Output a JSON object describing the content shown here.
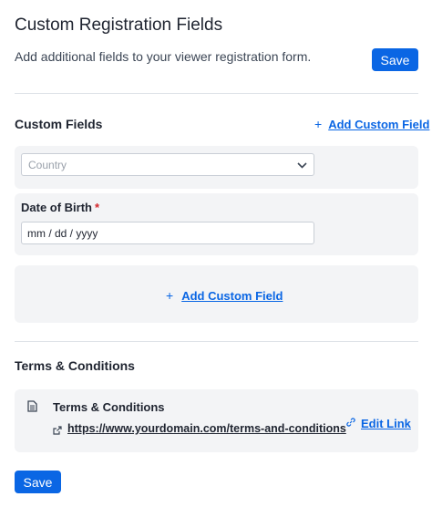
{
  "header": {
    "title": "Custom Registration Fields",
    "description": "Add additional fields to your viewer registration form.",
    "save_label": "Save"
  },
  "custom_fields": {
    "section_title": "Custom Fields",
    "add_label": "Add Custom Field",
    "country_select": {
      "placeholder": "Country"
    },
    "dob": {
      "label": "Date of Birth",
      "required_mark": "*",
      "placeholder": "mm / dd / yyyy"
    },
    "add_card_label": "Add Custom Field"
  },
  "terms": {
    "section_title": "Terms & Conditions",
    "item_title": "Terms & Conditions",
    "url": "https://www.yourdomain.com/terms-and-conditions",
    "edit_label": "Edit Link"
  },
  "footer": {
    "save_label": "Save"
  },
  "icons": {
    "plus": "plus-icon",
    "chevron": "chevron-down-icon",
    "document": "document-icon",
    "external": "external-link-icon",
    "link": "link-icon"
  },
  "colors": {
    "accent": "#0a66e4",
    "required": "#d3272c",
    "card": "#f3f4f6"
  }
}
